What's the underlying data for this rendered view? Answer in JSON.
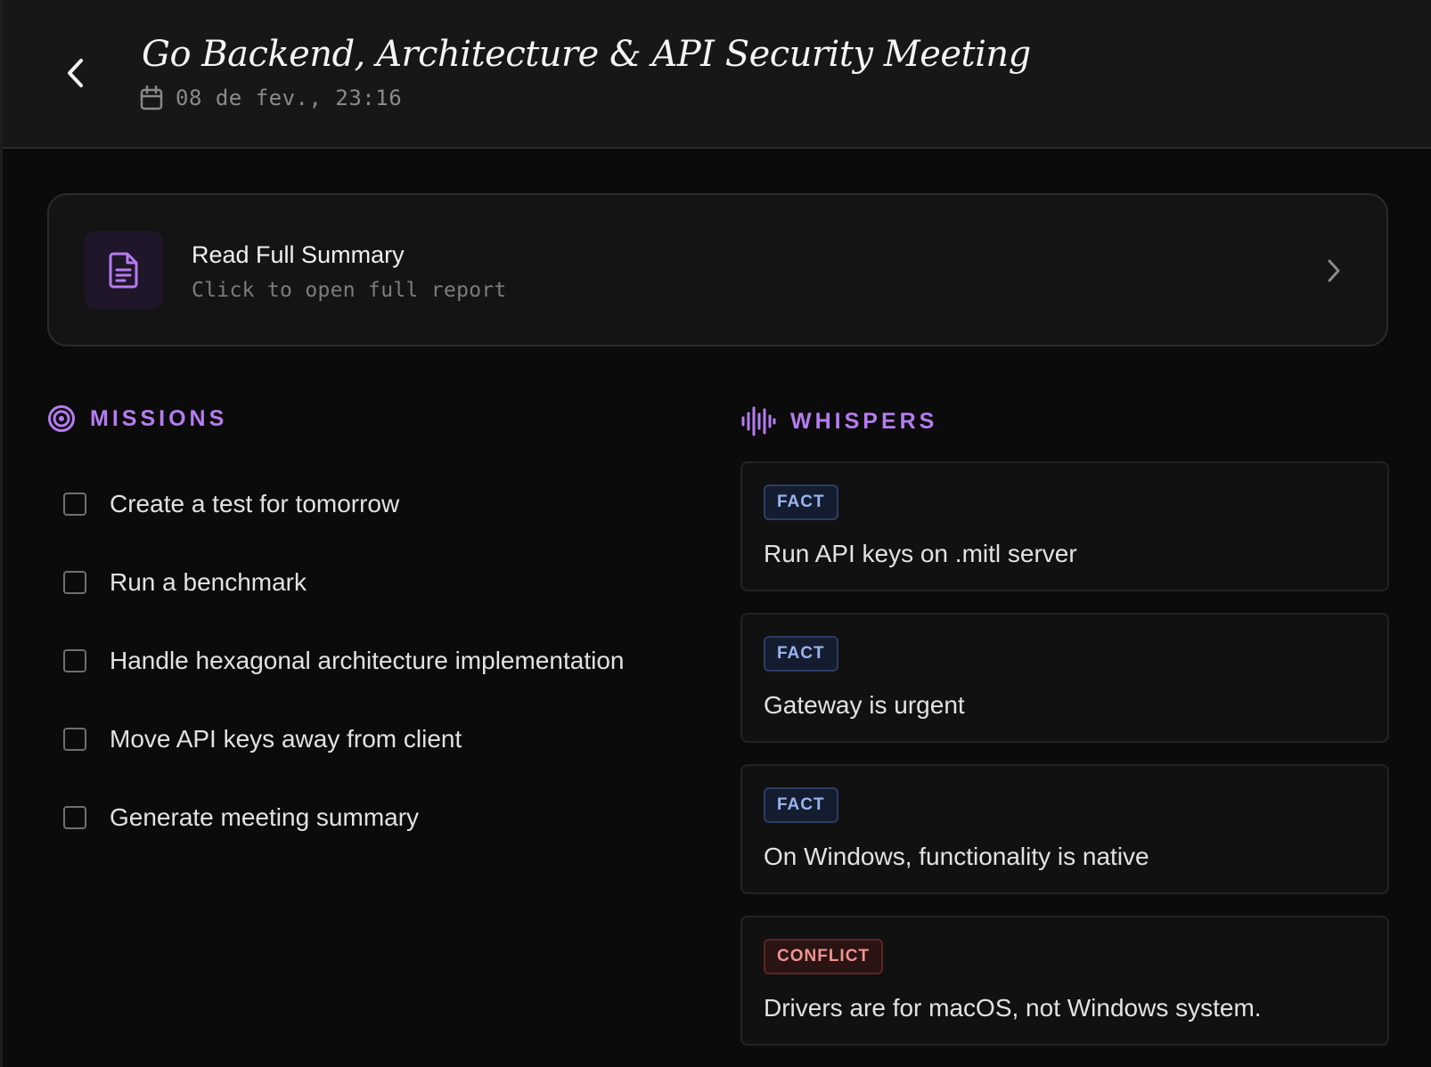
{
  "header": {
    "title": "Go Backend, Architecture & API Security Meeting",
    "date": "08 de fev., 23:16"
  },
  "summary": {
    "title": "Read Full Summary",
    "subtitle": "Click to open full report"
  },
  "missions": {
    "label": "MISSIONS",
    "items": [
      {
        "text": "Create a test for tomorrow",
        "checked": false
      },
      {
        "text": "Run a benchmark",
        "checked": false
      },
      {
        "text": "Handle hexagonal architecture implementation",
        "checked": false
      },
      {
        "text": "Move API keys away from client",
        "checked": false
      },
      {
        "text": "Generate meeting summary",
        "checked": false
      }
    ]
  },
  "whispers": {
    "label": "WHISPERS",
    "items": [
      {
        "badge": "FACT",
        "type": "fact",
        "text": "Run API keys on .mitl server"
      },
      {
        "badge": "FACT",
        "type": "fact",
        "text": "Gateway is urgent"
      },
      {
        "badge": "FACT",
        "type": "fact",
        "text": "On Windows, functionality is native"
      },
      {
        "badge": "CONFLICT",
        "type": "conflict",
        "text": "Drivers are for macOS, not Windows system."
      }
    ]
  },
  "colors": {
    "accent": "#b57cf0",
    "fact": "#9ab4ef",
    "conflict": "#f0948f",
    "background": "#0b0b0b",
    "header": "#171717"
  },
  "icons": {
    "back": "chevron-left-icon",
    "date": "calendar-icon",
    "summary": "document-icon",
    "summary_open": "chevron-right-icon",
    "missions": "target-icon",
    "whispers": "waveform-icon"
  }
}
